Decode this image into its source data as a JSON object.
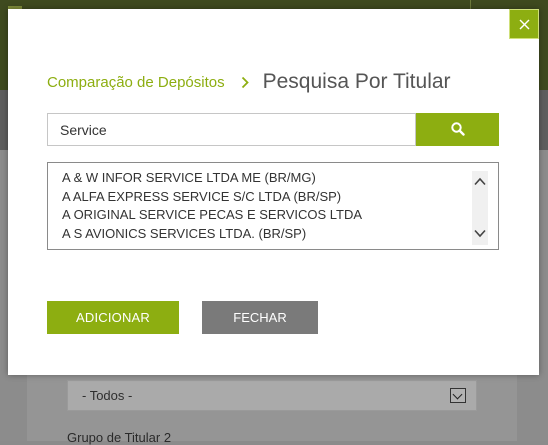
{
  "background": {
    "select_value": "- Todos -",
    "group_label": "Grupo de Titular 2"
  },
  "modal": {
    "breadcrumb": {
      "parent": "Comparação de Depósitos",
      "current": "Pesquisa Por Titular"
    },
    "search": {
      "value": "Service"
    },
    "results": [
      "A & W INFOR SERVICE LTDA ME (BR/MG)",
      "A ALFA EXPRESS SERVICE S/C LTDA (BR/SP)",
      "A ORIGINAL SERVICE PECAS E SERVICOS LTDA",
      "A S AVIONICS SERVICES LTDA. (BR/SP)"
    ],
    "buttons": {
      "add": "ADICIONAR",
      "close": "FECHAR"
    }
  },
  "colors": {
    "accent": "#8dae11",
    "secondary_button": "#7a7a7a"
  },
  "icons": [
    "close-icon",
    "chevron-right-icon",
    "search-icon",
    "chevron-up-icon",
    "chevron-down-icon"
  ]
}
